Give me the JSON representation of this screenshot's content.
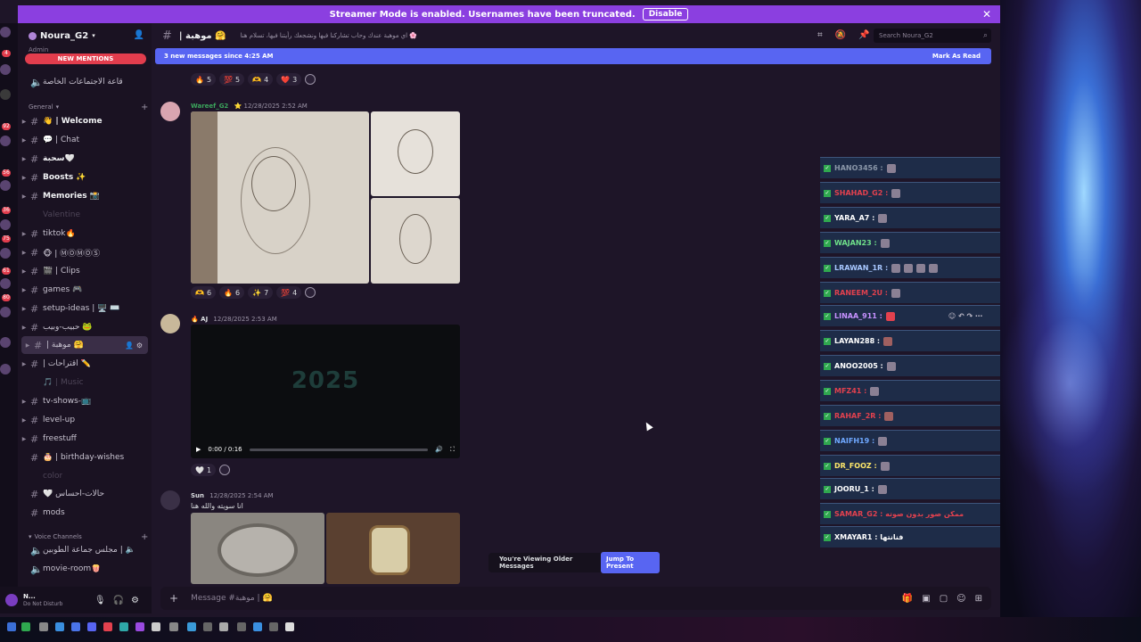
{
  "banner": {
    "text": "Streamer Mode is enabled. Usernames have been truncated.",
    "disable_label": "Disable"
  },
  "rail_badges": [
    "4",
    "92",
    "56",
    "36",
    "75",
    "61",
    "80",
    "8"
  ],
  "guild": {
    "name": "Noura_G2",
    "role": "Admin"
  },
  "new_mentions": "NEW MENTIONS",
  "sidebar": {
    "pinned_channel": "قاعة الاجتماعات الخاصة",
    "category_general": "General",
    "channels": [
      {
        "name": "👋 | Welcome"
      },
      {
        "name": "💬 | Chat"
      },
      {
        "name": "سحبة🤍"
      },
      {
        "name": "Boosts ✨"
      },
      {
        "name": "Memories 📸"
      },
      {
        "name": "Valentine"
      },
      {
        "name": "tiktok🔥"
      },
      {
        "name": "🐵 | ⓂⓄⓂⓄⓈ"
      },
      {
        "name": "🎬 | Clips"
      },
      {
        "name": "games 🎮"
      },
      {
        "name": "setup-ideas | 🖥️ ⌨️"
      },
      {
        "name": "حبيب-وبيب 🐸"
      },
      {
        "name": "| موهبة 🤗"
      },
      {
        "name": "| اقتراحات ✏️"
      },
      {
        "name": "🎵 | Music"
      },
      {
        "name": "tv-shows-📺"
      },
      {
        "name": "level-up"
      },
      {
        "name": "freestuff"
      },
      {
        "name": "🎂 | birthday-wishes"
      },
      {
        "name": "color"
      },
      {
        "name": "🤍 حالات-احساس"
      },
      {
        "name": "mods"
      }
    ],
    "category_voice": "Voice Channels",
    "voice": [
      {
        "name": "مجلس جماعة الطوبين | 🔈"
      },
      {
        "name": "movie-room🍿"
      }
    ]
  },
  "user": {
    "name": "N...",
    "status": "Do Not Disturb"
  },
  "header": {
    "channel": "| موهبة 🤗",
    "topic": "اي موهبة عندك وحاب تشاركنا فيها ونشجعك رأيتنا فيها، تسلام هنا 🌸",
    "search_placeholder": "Search Noura_G2"
  },
  "new_messages": {
    "text": "3 new messages since 4:25 AM",
    "mark_read": "Mark As Read"
  },
  "messages": [
    {
      "reactions": [
        {
          "emoji": "🔥",
          "count": "5"
        },
        {
          "emoji": "💯",
          "count": "5"
        },
        {
          "emoji": "🫶",
          "count": "4"
        },
        {
          "emoji": "❤️",
          "count": "3"
        }
      ]
    },
    {
      "user": "Wareef_G2",
      "badge": "⭐",
      "time": "12/28/2025 2:52 AM",
      "reactions": [
        {
          "emoji": "🫶",
          "count": "6"
        },
        {
          "emoji": "🔥",
          "count": "6"
        },
        {
          "emoji": "✨",
          "count": "7"
        },
        {
          "emoji": "💯",
          "count": "4"
        }
      ]
    },
    {
      "user": "🔥 AJ",
      "time": "12/28/2025 2:53 AM",
      "video_text": "2025",
      "video_time": "0:00 / 0:16",
      "reactions": [
        {
          "emoji": "🤍",
          "count": "1"
        }
      ]
    },
    {
      "user": "Sun",
      "time": "12/28/2025 2:54 AM",
      "text": "انا سويته والله هنا"
    }
  ],
  "overlay_rows": [
    {
      "name": "HANO3456 :",
      "color": "#8a96a8"
    },
    {
      "name": "SHAHAD_G2 :",
      "color": "#e2414e"
    },
    {
      "name": "YARA_A7 :",
      "color": "#ffffff"
    },
    {
      "name": "WAJAN23 :",
      "color": "#6fe08a"
    },
    {
      "name": "LRAWAN_1R :",
      "color": "#a8c8ff"
    },
    {
      "name": "RANEEM_2U :",
      "color": "#e2414e"
    },
    {
      "name": "LINAA_911 :",
      "color": "#c792ff"
    },
    {
      "name": "LAYAN288 :",
      "color": "#ffffff"
    },
    {
      "name": "ANOO2005 :",
      "color": "#ffffff"
    },
    {
      "name": "MFZ41 :",
      "color": "#e2414e"
    },
    {
      "name": "RAHAF_2R :",
      "color": "#e2414e"
    },
    {
      "name": "NAIFH19 :",
      "color": "#6fa8ff"
    },
    {
      "name": "DR_FOOZ :",
      "color": "#ffe86a"
    },
    {
      "name": "JOORU_1 :",
      "color": "#ffffff"
    },
    {
      "name": "SAMAR_G2 : ممكن صور بدون صوته",
      "color": "#e2414e"
    },
    {
      "name": "XMAYAR1 : فنانتها",
      "color": "#ffffff"
    }
  ],
  "older": {
    "text": "You're Viewing Older Messages",
    "jump": "Jump To Present"
  },
  "composer": {
    "placeholder": "Message #موهبة | 🤗"
  },
  "colors": {
    "accent": "#5865f2",
    "banner": "#8b3fe0",
    "mention": "#e23d4d",
    "bg": "#1e1528"
  }
}
